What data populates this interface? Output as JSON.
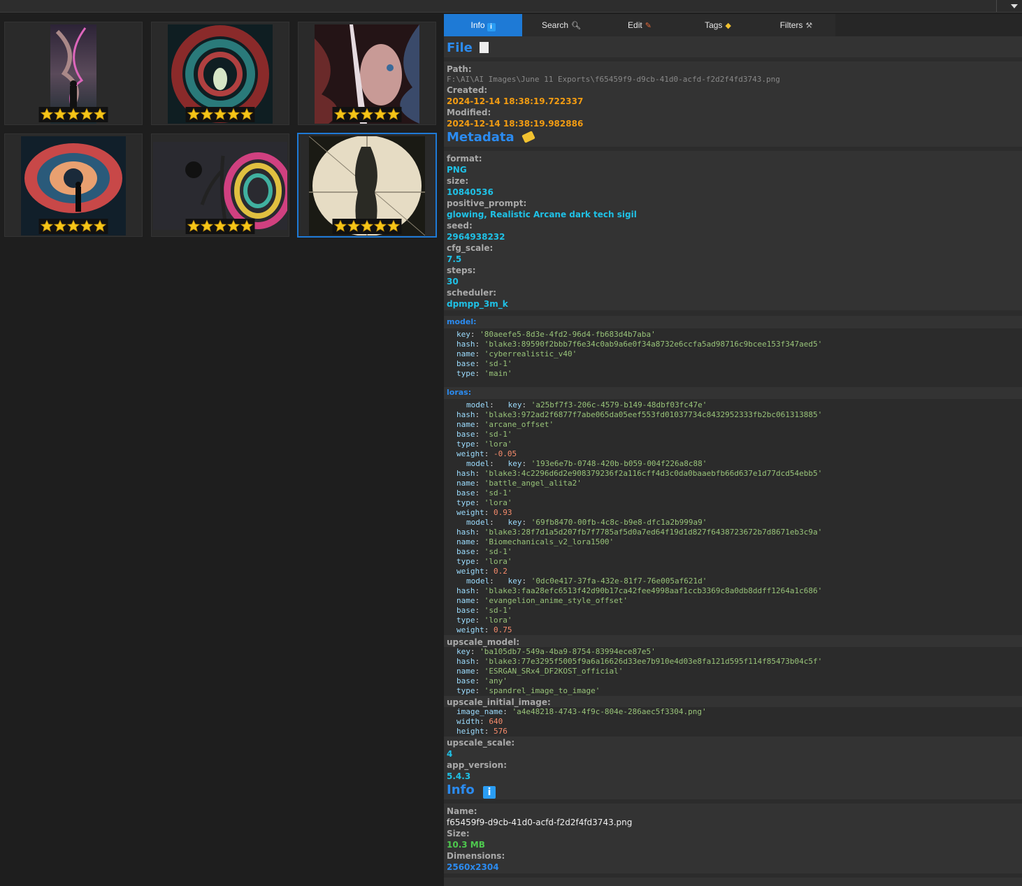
{
  "tabs": [
    {
      "label": "Info",
      "icon": "info-icon"
    },
    {
      "label": "Search",
      "icon": "magnifier-icon"
    },
    {
      "label": "Edit",
      "icon": "pencil-icon"
    },
    {
      "label": "Tags",
      "icon": "tag-icon"
    },
    {
      "label": "Filters",
      "icon": "wrench-icon"
    }
  ],
  "gallery": {
    "thumbnails": [
      {
        "rating": 5,
        "selected": false
      },
      {
        "rating": 5,
        "selected": false
      },
      {
        "rating": 5,
        "selected": false
      },
      {
        "rating": 5,
        "selected": false
      },
      {
        "rating": 5,
        "selected": false
      },
      {
        "rating": 5,
        "selected": true
      }
    ]
  },
  "file": {
    "heading": "File",
    "path_label": "Path:",
    "path": "F:\\AI\\AI Images\\June 11 Exports\\f65459f9-d9cb-41d0-acfd-f2d2f4fd3743.png",
    "created_label": "Created:",
    "created": "2024-12-14 18:38:19.722337",
    "modified_label": "Modified:",
    "modified": "2024-12-14 18:38:19.982886"
  },
  "metadata": {
    "heading": "Metadata",
    "format_label": "format:",
    "format": "PNG",
    "size_label": "size:",
    "size": "10840536",
    "positive_prompt_label": "positive_prompt:",
    "positive_prompt": "glowing, Realistic Arcane dark tech sigil",
    "seed_label": "seed:",
    "seed": "2964938232",
    "cfg_scale_label": "cfg_scale:",
    "cfg_scale": "7.5",
    "steps_label": "steps:",
    "steps": "30",
    "scheduler_label": "scheduler:",
    "scheduler": "dpmpp_3m_k",
    "model_label": "model:",
    "model": {
      "key": "'80aeefe5-8d3e-4fd2-96d4-fb683d4b7aba'",
      "hash": "'blake3:89590f2bbb7f6e34c0ab9a6e0f34a8732e6ccfa5ad98716c9bcee153f347aed5'",
      "name": "'cyberrealistic_v40'",
      "base": "'sd-1'",
      "type": "'main'"
    },
    "loras_label": "loras:",
    "loras": [
      {
        "key": "'a25bf7f3-206c-4579-b149-48dbf03fc47e'",
        "hash": "'blake3:972ad2f6877f7abe065da05eef553fd01037734c8432952333fb2bc061313885'",
        "name": "'arcane_offset'",
        "base": "'sd-1'",
        "type": "'lora'",
        "weight": "-0.05"
      },
      {
        "key": "'193e6e7b-0748-420b-b059-004f226a8c88'",
        "hash": "'blake3:4c2296d6d2e908379236f2a116cff4d3c0da0baaebfb66d637e1d77dcd54ebb5'",
        "name": "'battle_angel_alita2'",
        "base": "'sd-1'",
        "type": "'lora'",
        "weight": "0.93"
      },
      {
        "key": "'69fb8470-00fb-4c8c-b9e8-dfc1a2b999a9'",
        "hash": "'blake3:28f7d1a5d207fb7f7785af5d0a7ed64f19d1d827f6438723672b7d8671eb3c9a'",
        "name": "'Biomechanicals_v2_lora1500'",
        "base": "'sd-1'",
        "type": "'lora'",
        "weight": "0.2"
      },
      {
        "key": "'0dc0e417-37fa-432e-81f7-76e005af621d'",
        "hash": "'blake3:faa28efc6513f42d90b17ca42fee4998aaf1ccb3369c8a0db8ddff1264a1c686'",
        "name": "'evangelion_anime_style_offset'",
        "base": "'sd-1'",
        "type": "'lora'",
        "weight": "0.75"
      }
    ],
    "upscale_model_label": "upscale_model:",
    "upscale_model": {
      "key": "'ba105db7-549a-4ba9-8754-83994ece87e5'",
      "hash": "'blake3:77e3295f5005f9a6a16626d33ee7b910e4d03e8fa121d595f114f85473b04c5f'",
      "name": "'ESRGAN_SRx4_DF2KOST_official'",
      "base": "'any'",
      "type": "'spandrel_image_to_image'"
    },
    "upscale_initial_image_label": "upscale_initial_image:",
    "upscale_initial_image": {
      "image_name": "'a4e48218-4743-4f9c-804e-286aec5f3304.png'",
      "width": "640",
      "height": "576"
    },
    "upscale_scale_label": "upscale_scale:",
    "upscale_scale": "4",
    "app_version_label": "app_version:",
    "app_version": "5.4.3"
  },
  "info": {
    "heading": "Info",
    "name_label": "Name:",
    "name": "f65459f9-d9cb-41d0-acfd-f2d2f4fd3743.png",
    "size_label": "Size:",
    "size": "10.3 MB",
    "dimensions_label": "Dimensions:",
    "dimensions": "2560x2304"
  },
  "colors": {
    "accent": "#1e7ad6",
    "heading": "#2b8bf0",
    "value_cyan": "#1fc1e6",
    "value_orange": "#f39c12",
    "value_green": "#4ec94e"
  }
}
